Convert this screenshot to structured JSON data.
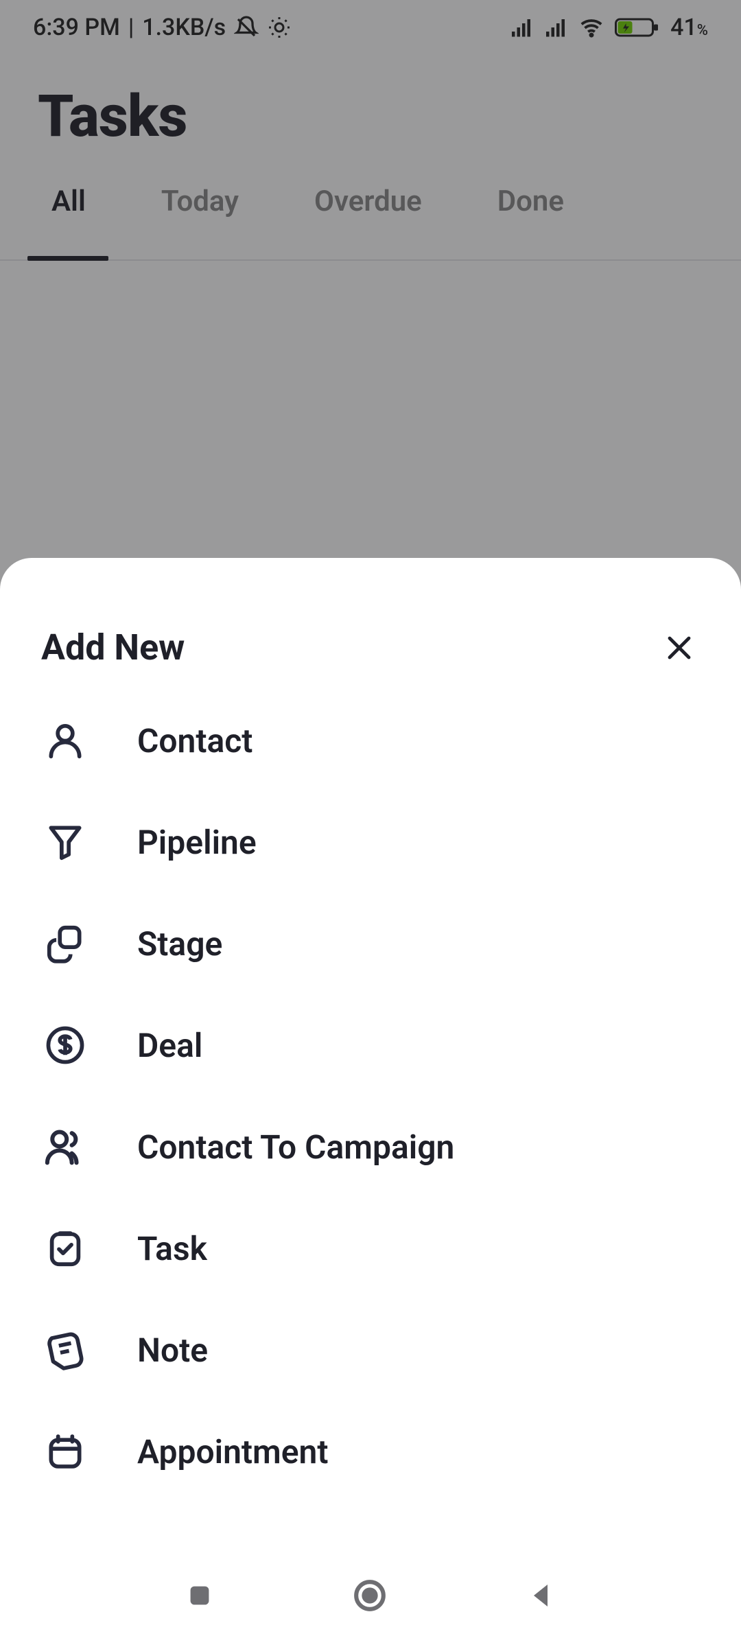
{
  "status": {
    "time": "6:39 PM",
    "net_speed": "1.3KB/s",
    "battery_pct": "41",
    "battery_pct_suffix": "%"
  },
  "header": {
    "title": "Tasks"
  },
  "tabs": [
    {
      "label": "All",
      "active": true
    },
    {
      "label": "Today",
      "active": false
    },
    {
      "label": "Overdue",
      "active": false
    },
    {
      "label": "Done",
      "active": false
    }
  ],
  "sheet": {
    "title": "Add New",
    "items": [
      {
        "icon": "person-icon",
        "label": "Contact"
      },
      {
        "icon": "funnel-icon",
        "label": "Pipeline"
      },
      {
        "icon": "stack-icon",
        "label": "Stage"
      },
      {
        "icon": "dollar-icon",
        "label": "Deal"
      },
      {
        "icon": "people-icon",
        "label": "Contact To Campaign"
      },
      {
        "icon": "clipboard-check-icon",
        "label": "Task"
      },
      {
        "icon": "note-icon",
        "label": "Note"
      },
      {
        "icon": "calendar-icon",
        "label": "Appointment"
      }
    ]
  }
}
